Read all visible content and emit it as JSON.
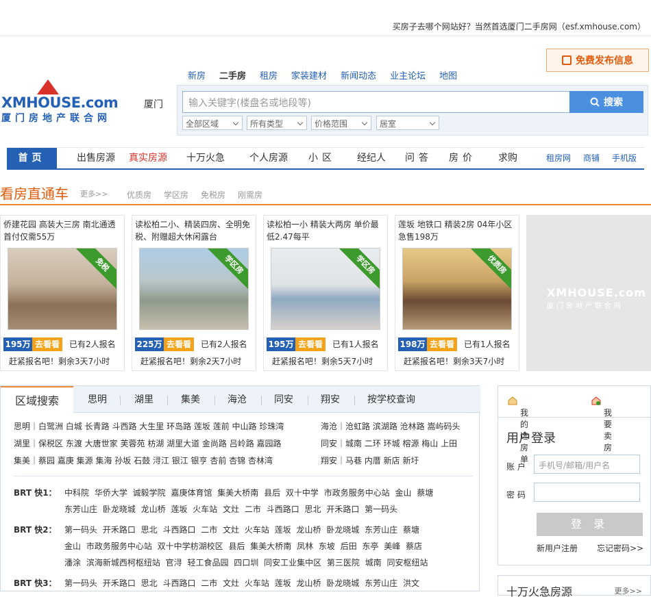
{
  "header": {
    "slogan": "买房子去哪个网站好？当然首选厦门二手房网（esf.xmhouse.com）",
    "logo_en": "XMHOUSE.com",
    "logo_cn": "厦门房地产联合网",
    "city": "厦门",
    "publish_label": "免费发布信息",
    "top_nav": [
      "新房",
      "二手房",
      "租房",
      "家装建材",
      "新闻动态",
      "业主论坛",
      "地图"
    ],
    "top_nav_active": "二手房"
  },
  "search": {
    "placeholder": "输入关键字(楼盘名或地段等)",
    "button": "搜索",
    "filters": [
      "全部区域",
      "所有类型",
      "价格范围",
      "居室"
    ]
  },
  "main_nav": {
    "items": [
      "首页",
      "出售房源",
      "真实房源",
      "十万火急",
      "个人房源",
      "小区",
      "经纪人",
      "问答",
      "房价",
      "求购"
    ],
    "right_items": [
      "租房网",
      "商铺",
      "手机版"
    ]
  },
  "featured": {
    "title": "看房直通车",
    "more": "更多>>",
    "tags": [
      "优质房",
      "学区房",
      "免税房",
      "刚需房"
    ],
    "cards": [
      {
        "title": "侨建花园 高装大三房 南北通透首付仅需55万",
        "ribbon": "免税",
        "price": "195万",
        "go": "去看看",
        "count": "已有2人报名",
        "hurry": "赶紧报名吧！剩余3天7小时"
      },
      {
        "title": "读松柏二小、精装四房、全明免税、附赠超大休闲露台",
        "ribbon": "学区房",
        "price": "225万",
        "go": "去看看",
        "count": "已有2人报名",
        "hurry": "赶紧报名吧！剩余2天7小时"
      },
      {
        "title": "读松柏一小 精装大两房 单价最低2.47每平",
        "ribbon": "学区房",
        "price": "195万",
        "go": "去看看",
        "count": "已有1人报名",
        "hurry": "赶紧报名吧！剩余5天7小时"
      },
      {
        "title": "莲坂 地铁口 精装2房 04年小区急售198万",
        "ribbon": "优质房",
        "price": "198万",
        "go": "去看看",
        "count": "已有1人报名",
        "hurry": "赶紧报名吧！剩余3天7小时"
      }
    ],
    "ad_wm": "XMHOUSE.com",
    "ad_wm2": "厦门房地产联合网"
  },
  "area_search": {
    "tabs": [
      "区域搜索",
      "思明",
      "湖里",
      "集美",
      "海沧",
      "同安",
      "翔安",
      "按学校查询"
    ],
    "districts_left": [
      "思明｜白鹭洲 白城 长青路 斗西路 大生里 环岛路 莲坂 莲前 中山路 珍珠湾",
      "湖里｜保税区 东渡 大唐世家 芙蓉苑 枋湖 湖里大道 金尚路 吕岭路 嘉园路",
      "集美｜蔡园 嘉庚 集源 集海 孙坂 石鼓 浔江 银江 银亨 杏前 杏锦 杏林湾"
    ],
    "districts_right": [
      "海沧｜沧虹路 滨湖路 沧林路 嵩屿码头",
      "同安｜城南 二环 环城 榕源 梅山 上田",
      "翔安｜马巷 内厝 新店 新圩"
    ],
    "brt": [
      {
        "label": "BRT 快1：",
        "lines": [
          "中科院 华侨大学 诚毅学院 嘉庚体育馆 集美大桥南 县后 双十中学 市政务服务中心站 金山 蔡塘",
          "东芳山庄 卧龙晓城 龙山桥 莲坂 火车站 文灶 二市 斗西路口 思北 开禾路口 第一码头"
        ]
      },
      {
        "label": "BRT 快2：",
        "lines": [
          "第一码头 开禾路口 思北 斗西路口 二市 文灶 火车站 莲坂 龙山桥 卧龙晓城 东芳山庄 蔡塘",
          "金山 市政务服务中心站 双十中学枋湖校区 县后 集美大桥南 凤林 东坡 后田 东亭 美峰 蔡店",
          "潘涂 滨海新城西柯枢纽站 官浔 轻工食品园 四口圳 同安工业集中区 第三医院 城南 同安枢纽站"
        ]
      },
      {
        "label": "BRT 快3：",
        "lines": [
          "第一码头 开禾路口 思北 斗西路口 二市 文灶 火车站 莲坂 龙山桥 卧龙晓城 东芳山庄 洪文"
        ]
      }
    ]
  },
  "login": {
    "fav": "我的选房单",
    "sell": "我要卖房",
    "title": "用户登录",
    "account_label": "账 户",
    "account_placeholder": "手机号/邮箱/用户名",
    "password_label": "密 码",
    "button": "登 录",
    "register": "新用户注册",
    "forgot": "忘记密码>>"
  },
  "urgent": {
    "title": "十万火急房源",
    "more": "更多>>"
  }
}
